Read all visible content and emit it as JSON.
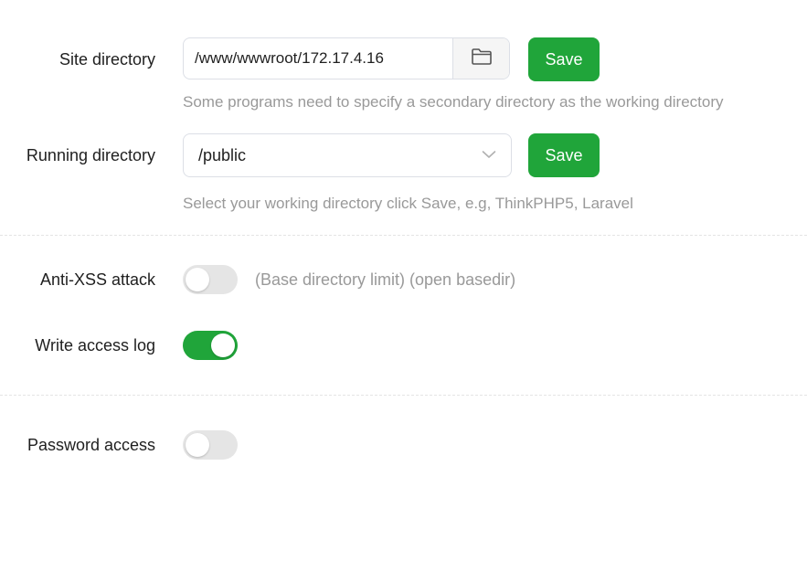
{
  "site_directory": {
    "label": "Site directory",
    "value": "/www/wwwroot/172.17.4.16",
    "folder_icon": "folder-icon",
    "save_label": "Save",
    "hint": "Some programs need to specify a secondary directory as the working directory"
  },
  "running_directory": {
    "label": "Running directory",
    "selected": "/public",
    "chevron_icon": "chevron-down-icon",
    "save_label": "Save",
    "hint": "Select your working directory click Save, e.g, ThinkPHP5, Laravel"
  },
  "anti_xss": {
    "label": "Anti-XSS attack",
    "enabled": false,
    "hint": "(Base directory limit) (open basedir)"
  },
  "access_log": {
    "label": "Write access log",
    "enabled": true
  },
  "password_access": {
    "label": "Password access",
    "enabled": false
  },
  "colors": {
    "accent": "#20a53a",
    "hint_text": "#999999",
    "toggle_off": "#e5e5e5"
  }
}
